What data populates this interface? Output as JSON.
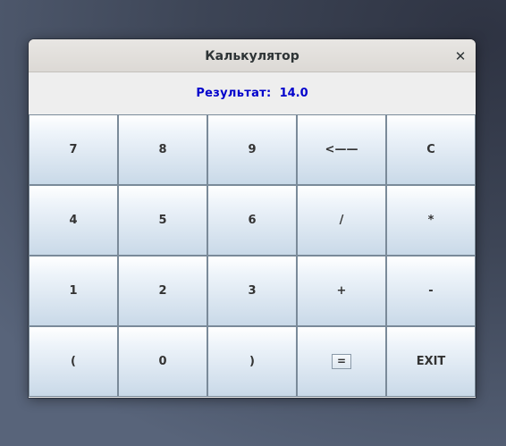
{
  "window": {
    "title": "Калькулятор",
    "close_glyph": "✕"
  },
  "display": {
    "label": "Результат:",
    "value": "14.0"
  },
  "keys": [
    {
      "label": "7",
      "name": "key-7"
    },
    {
      "label": "8",
      "name": "key-8"
    },
    {
      "label": "9",
      "name": "key-9"
    },
    {
      "label": "<——",
      "name": "key-backspace"
    },
    {
      "label": "C",
      "name": "key-clear"
    },
    {
      "label": "4",
      "name": "key-4"
    },
    {
      "label": "5",
      "name": "key-5"
    },
    {
      "label": "6",
      "name": "key-6"
    },
    {
      "label": "/",
      "name": "key-divide"
    },
    {
      "label": "*",
      "name": "key-multiply"
    },
    {
      "label": "1",
      "name": "key-1"
    },
    {
      "label": "2",
      "name": "key-2"
    },
    {
      "label": "3",
      "name": "key-3"
    },
    {
      "label": "+",
      "name": "key-plus"
    },
    {
      "label": "-",
      "name": "key-minus"
    },
    {
      "label": "(",
      "name": "key-open-paren"
    },
    {
      "label": "0",
      "name": "key-0"
    },
    {
      "label": ")",
      "name": "key-close-paren"
    },
    {
      "label": "=",
      "name": "key-equals"
    },
    {
      "label": "EXIT",
      "name": "key-exit"
    }
  ],
  "colors": {
    "result_text": "#0000cc",
    "button_border": "#7a8a99",
    "button_gradient_bottom": "#c9d9e8"
  }
}
